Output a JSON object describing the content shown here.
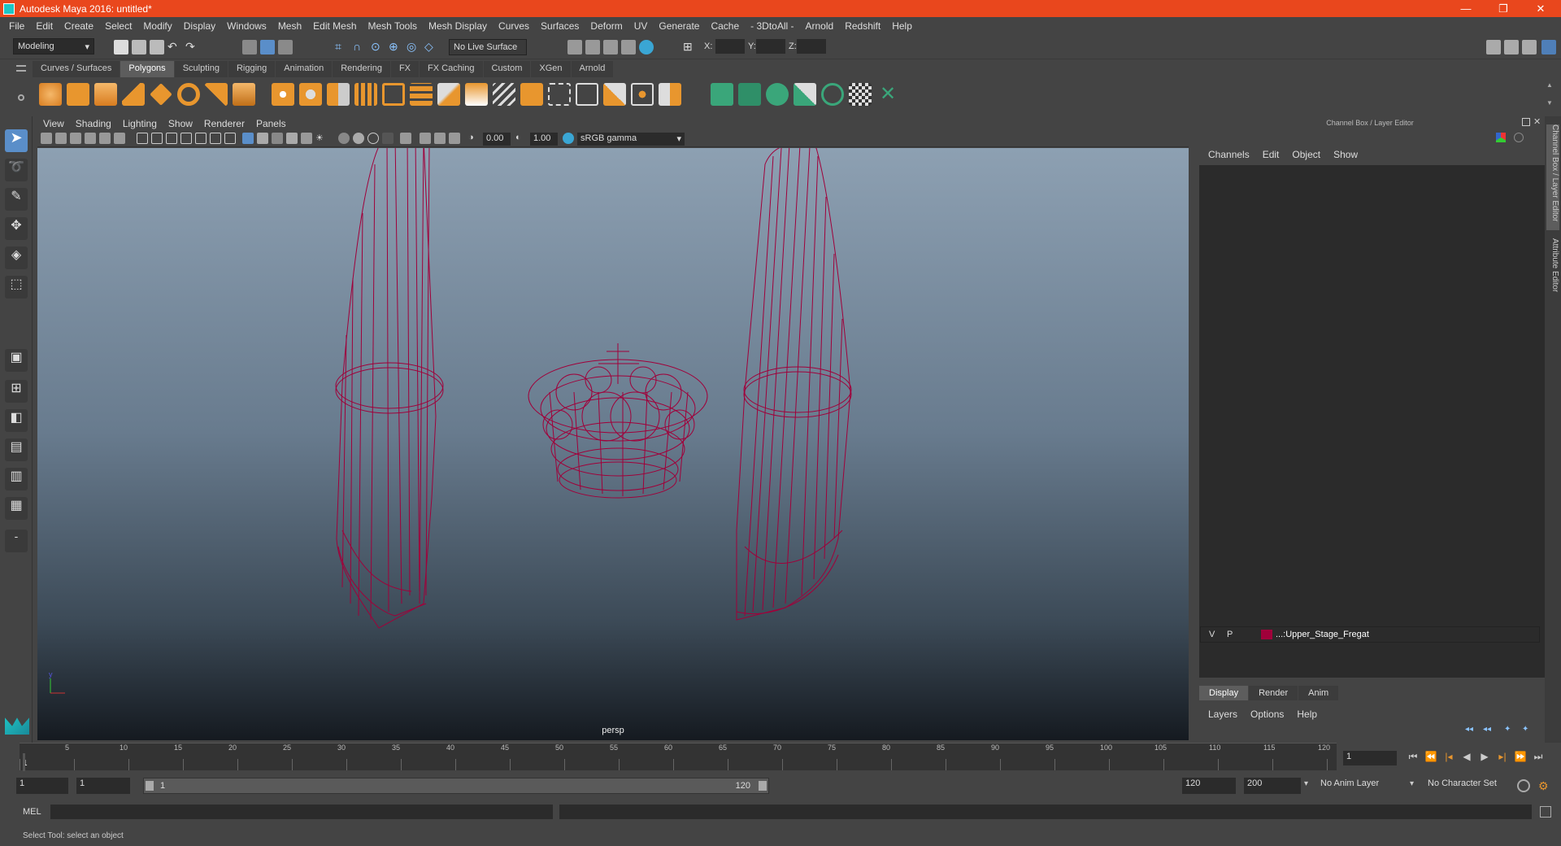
{
  "window": {
    "title": "Autodesk Maya 2016: untitled*",
    "controls": [
      "—",
      "❐",
      "✕"
    ]
  },
  "menubar": [
    "File",
    "Edit",
    "Create",
    "Select",
    "Modify",
    "Display",
    "Windows",
    "Mesh",
    "Edit Mesh",
    "Mesh Tools",
    "Mesh Display",
    "Curves",
    "Surfaces",
    "Deform",
    "UV",
    "Generate",
    "Cache",
    "- 3DtoAll -",
    "Arnold",
    "Redshift",
    "Help"
  ],
  "statusline": {
    "mode": "Modeling",
    "live_surface": "No Live Surface",
    "x_label": "X:",
    "y_label": "Y:",
    "z_label": "Z:"
  },
  "shelf_tabs": [
    "Curves / Surfaces",
    "Polygons",
    "Sculpting",
    "Rigging",
    "Animation",
    "Rendering",
    "FX",
    "FX Caching",
    "Custom",
    "XGen",
    "Arnold"
  ],
  "shelf_active": "Polygons",
  "viewport": {
    "menu": [
      "View",
      "Shading",
      "Lighting",
      "Show",
      "Renderer",
      "Panels"
    ],
    "exposure": "0.00",
    "gamma": "1.00",
    "color_space": "sRGB gamma",
    "camera_label": "persp",
    "wire_color": "#a0003a"
  },
  "channelbox": {
    "header": "Channel Box / Layer Editor",
    "menu": [
      "Channels",
      "Edit",
      "Object",
      "Show"
    ]
  },
  "layer_editor": {
    "tabs": [
      "Display",
      "Render",
      "Anim"
    ],
    "active_tab": "Display",
    "menu": [
      "Layers",
      "Options",
      "Help"
    ],
    "layer": {
      "v": "V",
      "p": "P",
      "name": "...:Upper_Stage_Fregat",
      "color": "#a0003a"
    }
  },
  "side_tabs": [
    "Channel Box / Layer Editor",
    "Attribute Editor"
  ],
  "timeline": {
    "ticks": [
      "5",
      "10",
      "15",
      "20",
      "25",
      "30",
      "35",
      "40",
      "45",
      "50",
      "55",
      "60",
      "65",
      "70",
      "75",
      "80",
      "85",
      "90",
      "95",
      "100",
      "105",
      "110",
      "115",
      "120"
    ],
    "current_frame": "1",
    "current_frame_field": "1"
  },
  "range": {
    "start": "1",
    "playback_start": "1",
    "slider_start": "1",
    "slider_end": "120",
    "playback_end": "120",
    "end": "200",
    "anim_layer": "No Anim Layer",
    "char_set": "No Character Set"
  },
  "cmdline": {
    "label": "MEL"
  },
  "helpline": {
    "text": "Select Tool: select an object"
  }
}
